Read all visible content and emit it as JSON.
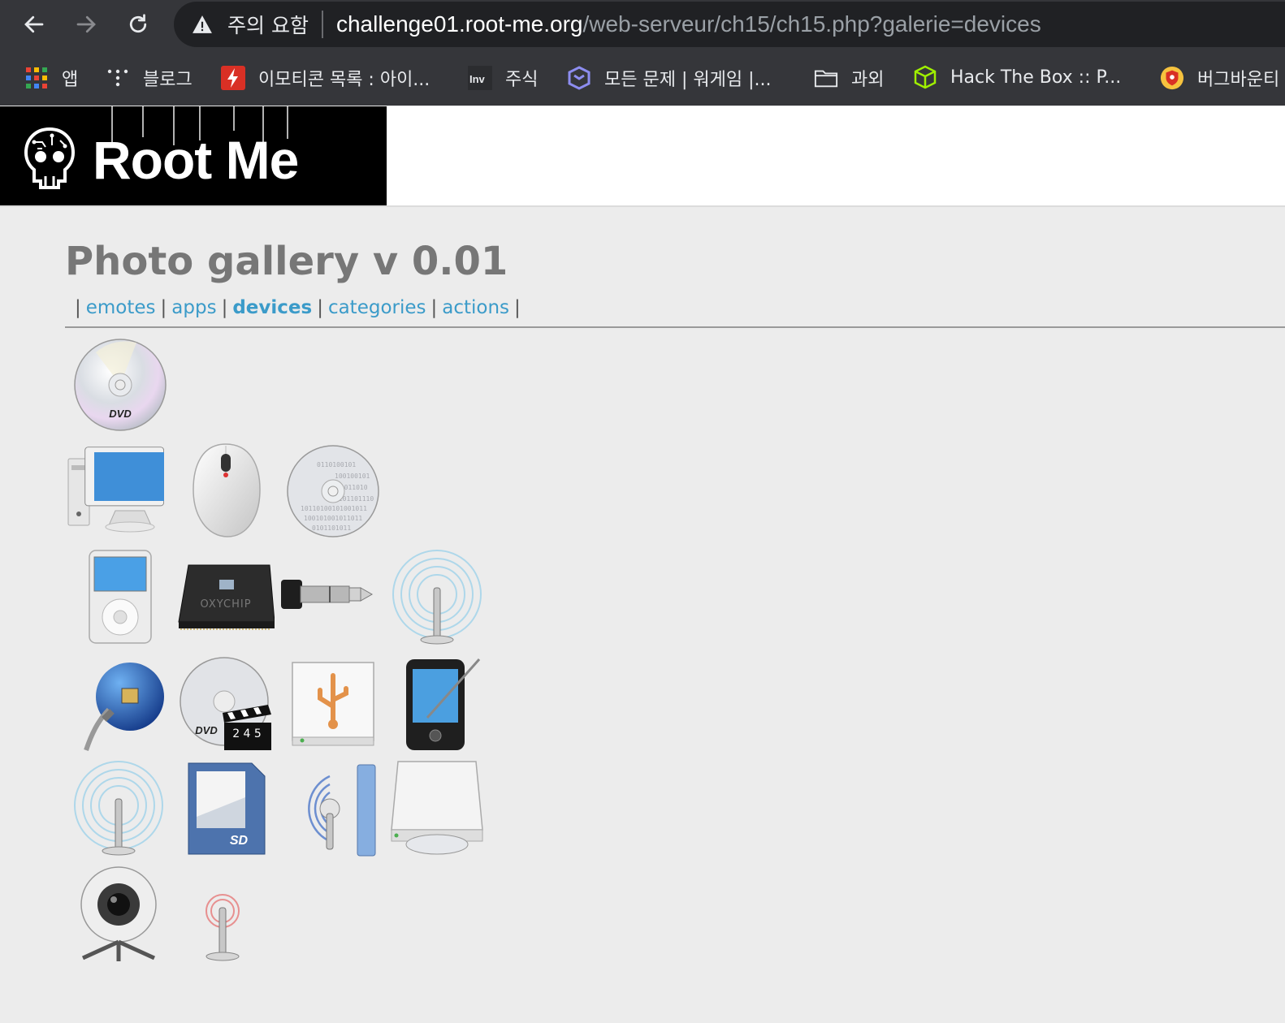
{
  "browser": {
    "security_warning": "주의 요함",
    "url_host": "challenge01.root-me.org",
    "url_path": "/web-serveur/ch15/ch15.php?galerie=devices",
    "bookmarks": [
      {
        "label": "앱",
        "icon": "apps-grid-icon"
      },
      {
        "label": "블로그",
        "icon": "dots-icon"
      },
      {
        "label": "이모티콘 목록 : 아이...",
        "icon": "red-bolt-icon"
      },
      {
        "label": "주식",
        "icon": "inv-icon"
      },
      {
        "label": "모든 문제 | 워게임 |...",
        "icon": "purple-cube-icon"
      },
      {
        "label": "과외",
        "icon": "folder-icon"
      },
      {
        "label": "Hack The Box :: P...",
        "icon": "green-cube-icon"
      },
      {
        "label": "버그바운티",
        "icon": "shield-badge-icon"
      }
    ]
  },
  "site": {
    "logo_text": "Root Me"
  },
  "gallery": {
    "title": "Photo gallery v 0.01",
    "nav": [
      {
        "label": "emotes",
        "active": false
      },
      {
        "label": "apps",
        "active": false
      },
      {
        "label": "devices",
        "active": true
      },
      {
        "label": "categories",
        "active": false
      },
      {
        "label": "actions",
        "active": false
      }
    ],
    "items": [
      {
        "icon": "dvd-disc-icon",
        "badge": "DVD"
      },
      {
        "icon": "desktop-computer-icon"
      },
      {
        "icon": "mouse-icon"
      },
      {
        "icon": "binary-disc-icon"
      },
      {
        "icon": "ipod-icon"
      },
      {
        "icon": "cpu-chip-icon",
        "badge": "OXYCHIP"
      },
      {
        "icon": "audio-jack-icon"
      },
      {
        "icon": "wireless-antenna-icon"
      },
      {
        "icon": "network-globe-icon"
      },
      {
        "icon": "dvd-video-icon",
        "badge": "DVD",
        "extra": "2 4 5"
      },
      {
        "icon": "usb-drive-icon"
      },
      {
        "icon": "pda-stylus-icon"
      },
      {
        "icon": "wireless-antenna-icon"
      },
      {
        "icon": "sd-card-icon",
        "badge": "SD"
      },
      {
        "icon": "bluetooth-antenna-icon"
      },
      {
        "icon": "optical-drive-icon"
      },
      {
        "icon": "webcam-icon"
      },
      {
        "icon": "red-antenna-icon"
      }
    ]
  }
}
